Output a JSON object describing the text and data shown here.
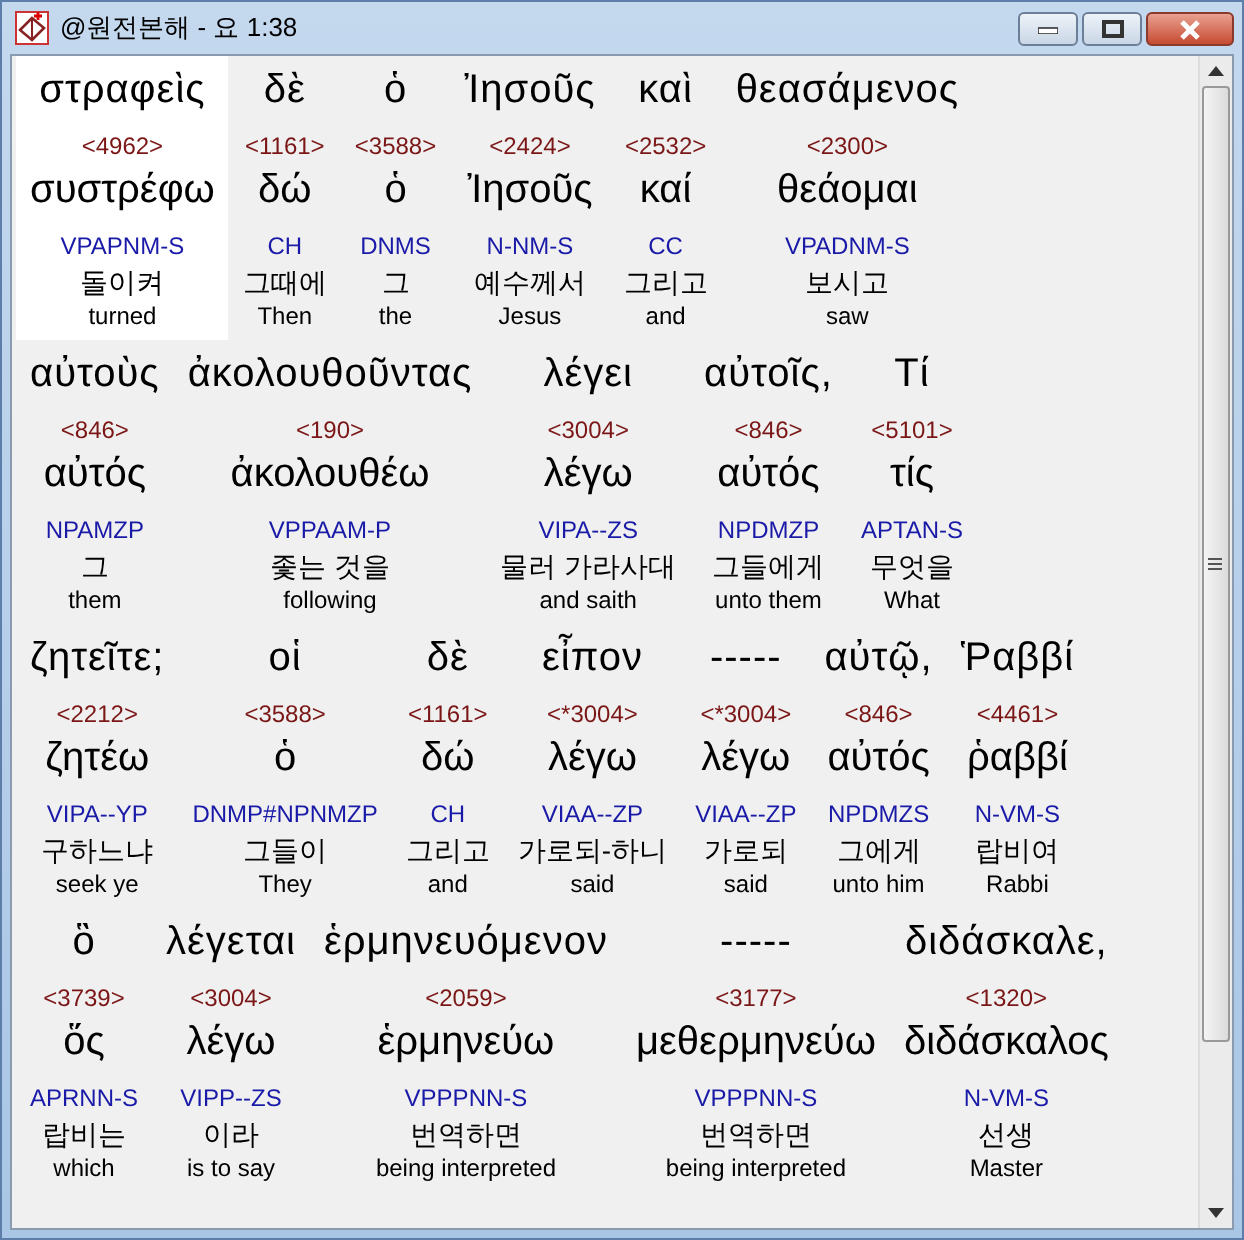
{
  "window": {
    "title": "@원전본해 - 요 1:38"
  },
  "lines": [
    {
      "words": [
        {
          "greek": "στραφεὶς",
          "strong": "<4962>",
          "lemma": "συστρέφω",
          "parsing": "VPAPNM-S",
          "korean": "돌이켜",
          "english": "turned",
          "selected": true
        },
        {
          "greek": "δὲ",
          "strong": "<1161>",
          "lemma": "δώ",
          "parsing": "CH",
          "korean": "그때에",
          "english": "Then",
          "selected": false
        },
        {
          "greek": "ὁ",
          "strong": "<3588>",
          "lemma": "ὁ",
          "parsing": "DNMS",
          "korean": "그",
          "english": "the",
          "selected": false
        },
        {
          "greek": "Ἰησοῦς",
          "strong": "<2424>",
          "lemma": "Ἰησοῦς",
          "parsing": "N-NM-S",
          "korean": "예수께서",
          "english": "Jesus",
          "selected": false
        },
        {
          "greek": "καὶ",
          "strong": "<2532>",
          "lemma": "καί",
          "parsing": "CC",
          "korean": "그리고",
          "english": "and",
          "selected": false
        },
        {
          "greek": "θεασάμενος",
          "strong": "<2300>",
          "lemma": "θεάομαι",
          "parsing": "VPADNM-S",
          "korean": "보시고",
          "english": "saw",
          "selected": false
        }
      ]
    },
    {
      "words": [
        {
          "greek": "αὐτοὺς",
          "strong": "<846>",
          "lemma": "αὐτός",
          "parsing": "NPAMZP",
          "korean": "그",
          "english": "them",
          "selected": false
        },
        {
          "greek": "ἀκολουθοῦντας",
          "strong": "<190>",
          "lemma": "ἀκολουθέω",
          "parsing": "VPPAAM-P",
          "korean": "좇는 것을",
          "english": "following",
          "selected": false
        },
        {
          "greek": "λέγει",
          "strong": "<3004>",
          "lemma": "λέγω",
          "parsing": "VIPA--ZS",
          "korean": "물러 가라사대",
          "english": "and saith",
          "selected": false
        },
        {
          "greek": "αὐτοῖς,",
          "strong": "<846>",
          "lemma": "αὐτός",
          "parsing": "NPDMZP",
          "korean": "그들에게",
          "english": "unto them",
          "selected": false
        },
        {
          "greek": "Τί",
          "strong": "<5101>",
          "lemma": "τίς",
          "parsing": "APTAN-S",
          "korean": "무엇을",
          "english": "What",
          "selected": false
        }
      ]
    },
    {
      "words": [
        {
          "greek": "ζητεῖτε;",
          "strong": "<2212>",
          "lemma": "ζητέω",
          "parsing": "VIPA--YP",
          "korean": "구하느냐",
          "english": "seek ye",
          "selected": false
        },
        {
          "greek": "οἱ",
          "strong": "<3588>",
          "lemma": "ὁ",
          "parsing": "DNMP#NPNMZP",
          "korean": "그들이",
          "english": "They",
          "selected": false
        },
        {
          "greek": "δὲ",
          "strong": "<1161>",
          "lemma": "δώ",
          "parsing": "CH",
          "korean": "그리고",
          "english": "and",
          "selected": false
        },
        {
          "greek": "εἶπον",
          "strong": "<*3004>",
          "lemma": "λέγω",
          "parsing": "VIAA--ZP",
          "korean": "가로되-하니",
          "english": "said",
          "selected": false
        },
        {
          "greek": "-----",
          "strong": "<*3004>",
          "lemma": "λέγω",
          "parsing": "VIAA--ZP",
          "korean": "가로되",
          "english": "said",
          "selected": false
        },
        {
          "greek": "αὐτῷ,",
          "strong": "<846>",
          "lemma": "αὐτός",
          "parsing": "NPDMZS",
          "korean": "그에게",
          "english": "unto him",
          "selected": false
        },
        {
          "greek": "Ῥαββί",
          "strong": "<4461>",
          "lemma": "ῥαββί",
          "parsing": "N-VM-S",
          "korean": "랍비여",
          "english": "Rabbi",
          "selected": false
        }
      ]
    },
    {
      "words": [
        {
          "greek": "ὃ",
          "strong": "<3739>",
          "lemma": "ὅς",
          "parsing": "APRNN-S",
          "korean": "랍비는",
          "english": "which",
          "selected": false
        },
        {
          "greek": "λέγεται",
          "strong": "<3004>",
          "lemma": "λέγω",
          "parsing": "VIPP--ZS",
          "korean": "이라",
          "english": "is to say",
          "selected": false
        },
        {
          "greek": "ἑρμηνευόμενον",
          "strong": "<2059>",
          "lemma": "ἑρμηνεύω",
          "parsing": "VPPPNN-S",
          "korean": "번역하면",
          "english": "being interpreted",
          "selected": false
        },
        {
          "greek": "-----",
          "strong": "<3177>",
          "lemma": "μεθερμηνεύω",
          "parsing": "VPPPNN-S",
          "korean": "번역하면",
          "english": "being interpreted",
          "selected": false
        },
        {
          "greek": "διδάσκαλε,",
          "strong": "<1320>",
          "lemma": "διδάσκαλος",
          "parsing": "N-VM-S",
          "korean": "선생",
          "english": "Master",
          "selected": false
        }
      ]
    }
  ]
}
